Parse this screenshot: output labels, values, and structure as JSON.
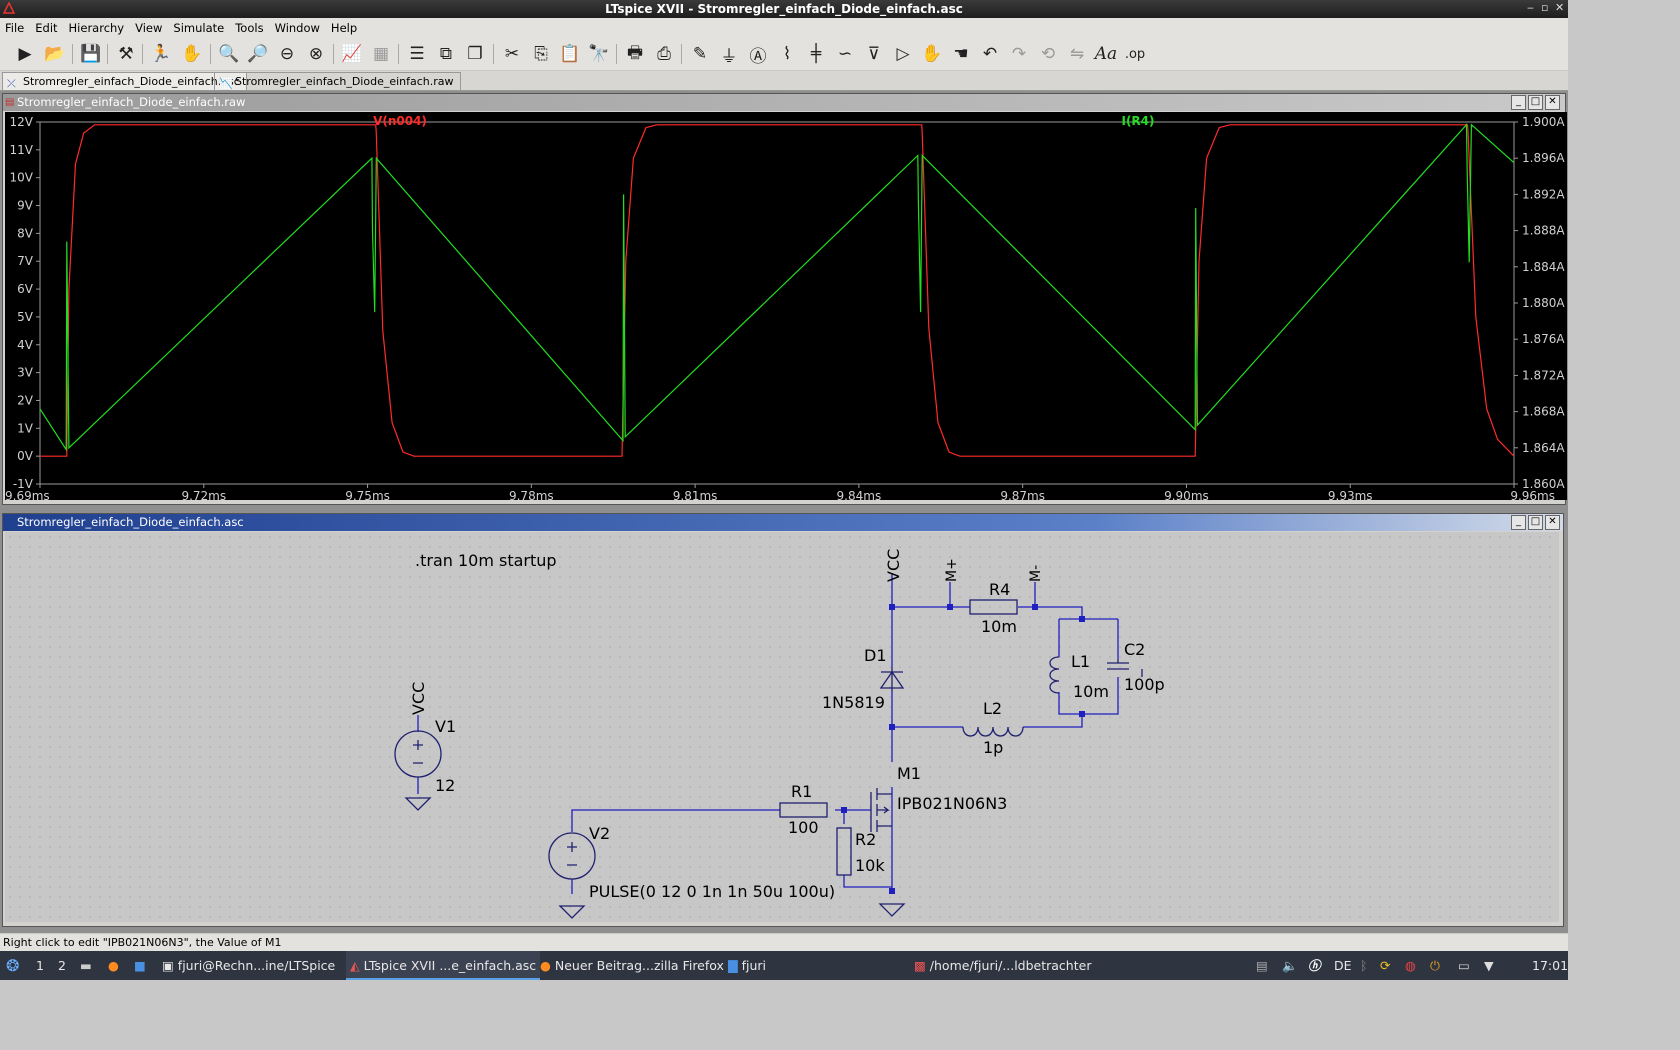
{
  "window": {
    "title": "LTspice XVII - Stromregler_einfach_Diode_einfach.asc"
  },
  "menu": [
    "File",
    "Edit",
    "Hierarchy",
    "View",
    "Simulate",
    "Tools",
    "Window",
    "Help"
  ],
  "toolbar_icons": [
    "run-icon",
    "open-icon",
    "save-icon",
    "hammer-icon",
    "run-man-icon",
    "halt-hand-icon",
    "zoom-in-icon",
    "zoom-area-icon",
    "zoom-out-icon",
    "zoom-fit-icon",
    "autorange-icon",
    "grid-icon",
    "tile-horizontal-icon",
    "tile-vertical-icon",
    "cascade-icon",
    "cut-icon",
    "copy-icon",
    "paste-icon",
    "find-icon",
    "print-preview-icon",
    "print-icon",
    "wire-icon",
    "ground-icon",
    "label-icon",
    "resistor-icon",
    "capacitor-icon",
    "inductor-icon",
    "diode-icon",
    "component-icon",
    "move-icon",
    "drag-icon",
    "undo-icon",
    "redo-icon",
    "rotate-icon",
    "mirror-icon",
    "text-icon",
    "spice-directive-icon"
  ],
  "tabs": [
    {
      "label": "Stromregler_einfach_Diode_einfach.asc",
      "icon": "schematic-icon"
    },
    {
      "label": "Stromregler_einfach_Diode_einfach.raw",
      "icon": "waveform-icon"
    }
  ],
  "waveform_window": {
    "title": "Stromregler_einfach_Diode_einfach.raw"
  },
  "schematic_window": {
    "title": "Stromregler_einfach_Diode_einfach.asc"
  },
  "colors": {
    "trace1": "#ff2b2b",
    "trace2": "#22dd22",
    "wire": "#2020c0",
    "component": "#202070"
  },
  "chart_data": {
    "type": "line",
    "series": [
      {
        "name": "V(n004)",
        "axis": "left",
        "x": [
          9.69,
          9.6948,
          9.6949,
          9.6953,
          9.6965,
          9.698,
          9.7,
          9.7515,
          9.7516,
          9.7528,
          9.7545,
          9.7565,
          9.7585,
          9.7965,
          9.7966,
          9.7973,
          9.7987,
          9.801,
          9.803,
          9.8515,
          9.8516,
          9.8528,
          9.8545,
          9.8565,
          9.8585,
          9.9015,
          9.9016,
          9.9023,
          9.9037,
          9.906,
          9.908,
          9.9515,
          9.9516,
          9.953,
          9.955,
          9.957,
          9.96
        ],
        "y": [
          0,
          0,
          0,
          6,
          10.5,
          11.6,
          11.9,
          11.9,
          11.6,
          4.5,
          1.2,
          0.15,
          0.0,
          0.0,
          0.0,
          7.0,
          10.7,
          11.8,
          11.9,
          11.9,
          11.6,
          4.6,
          1.2,
          0.15,
          0.0,
          0.0,
          0.0,
          7.0,
          10.7,
          11.8,
          11.9,
          11.9,
          11.6,
          5.0,
          1.7,
          0.6,
          0.0
        ]
      },
      {
        "name": "I(R4)",
        "axis": "right",
        "x": [
          9.69,
          9.6948,
          9.6949,
          9.6953,
          9.7508,
          9.7509,
          9.7513,
          9.7516,
          9.7968,
          9.7969,
          9.7972,
          9.8508,
          9.8509,
          9.8513,
          9.8516,
          9.9016,
          9.9017,
          9.902,
          9.9513,
          9.9514,
          9.9518,
          9.9522,
          9.96
        ],
        "y": [
          1.8683,
          1.8638,
          1.8868,
          1.864,
          1.896,
          1.888,
          1.879,
          1.896,
          1.8648,
          1.892,
          1.8652,
          1.8963,
          1.891,
          1.879,
          1.8963,
          1.866,
          1.8905,
          1.8665,
          1.8997,
          1.895,
          1.8845,
          1.8997,
          1.8955
        ]
      }
    ],
    "xlabels": [
      "9.69ms",
      "9.72ms",
      "9.75ms",
      "9.78ms",
      "9.81ms",
      "9.84ms",
      "9.87ms",
      "9.90ms",
      "9.93ms",
      "9.96ms"
    ],
    "xlim": [
      9.69,
      9.96
    ],
    "ylabels_left": [
      "12V",
      "11V",
      "10V",
      "9V",
      "8V",
      "7V",
      "6V",
      "5V",
      "4V",
      "3V",
      "2V",
      "1V",
      "0V",
      "-1V"
    ],
    "ylim_left": [
      -1,
      12
    ],
    "ylabels_right": [
      "1.900A",
      "1.896A",
      "1.892A",
      "1.888A",
      "1.884A",
      "1.880A",
      "1.876A",
      "1.872A",
      "1.868A",
      "1.864A",
      "1.860A"
    ],
    "ylim_right": [
      1.86,
      1.9
    ],
    "grid": false,
    "legend": "top"
  },
  "schematic": {
    "directive": ".tran 10m startup",
    "V1": {
      "name": "V1",
      "value": "12",
      "net": "VCC"
    },
    "V2": {
      "name": "V2",
      "value": "PULSE(0 12 0 1n 1n 50u 100u)"
    },
    "R1": {
      "name": "R1",
      "value": "100"
    },
    "R2": {
      "name": "R2",
      "value": "10k"
    },
    "R4": {
      "name": "R4",
      "value": "10m"
    },
    "L1": {
      "name": "L1",
      "value": "10m"
    },
    "L2": {
      "name": "L2",
      "value": "1p"
    },
    "C2": {
      "name": "C2",
      "value": "100p"
    },
    "D1": {
      "name": "D1",
      "value": "1N5819"
    },
    "M1": {
      "name": "M1",
      "value": "IPB021N06N3"
    },
    "labels": {
      "vcc_top": "VCC",
      "m_plus": "M+",
      "m_minus": "M-"
    }
  },
  "status_text": "Right click to edit \"IPB021N06N3\", the Value of M1",
  "taskbar": {
    "workspaces": [
      "1",
      "2"
    ],
    "tasks": [
      "fjuri@Rechn...ine/LTSpice",
      "LTspice XVII ...e_einfach.asc",
      "Neuer Beitrag...zilla Firefox",
      "fjuri",
      "/home/fjuri/...ldbetrachter"
    ],
    "keyboard_layout": "DE",
    "clock": "17:01"
  }
}
